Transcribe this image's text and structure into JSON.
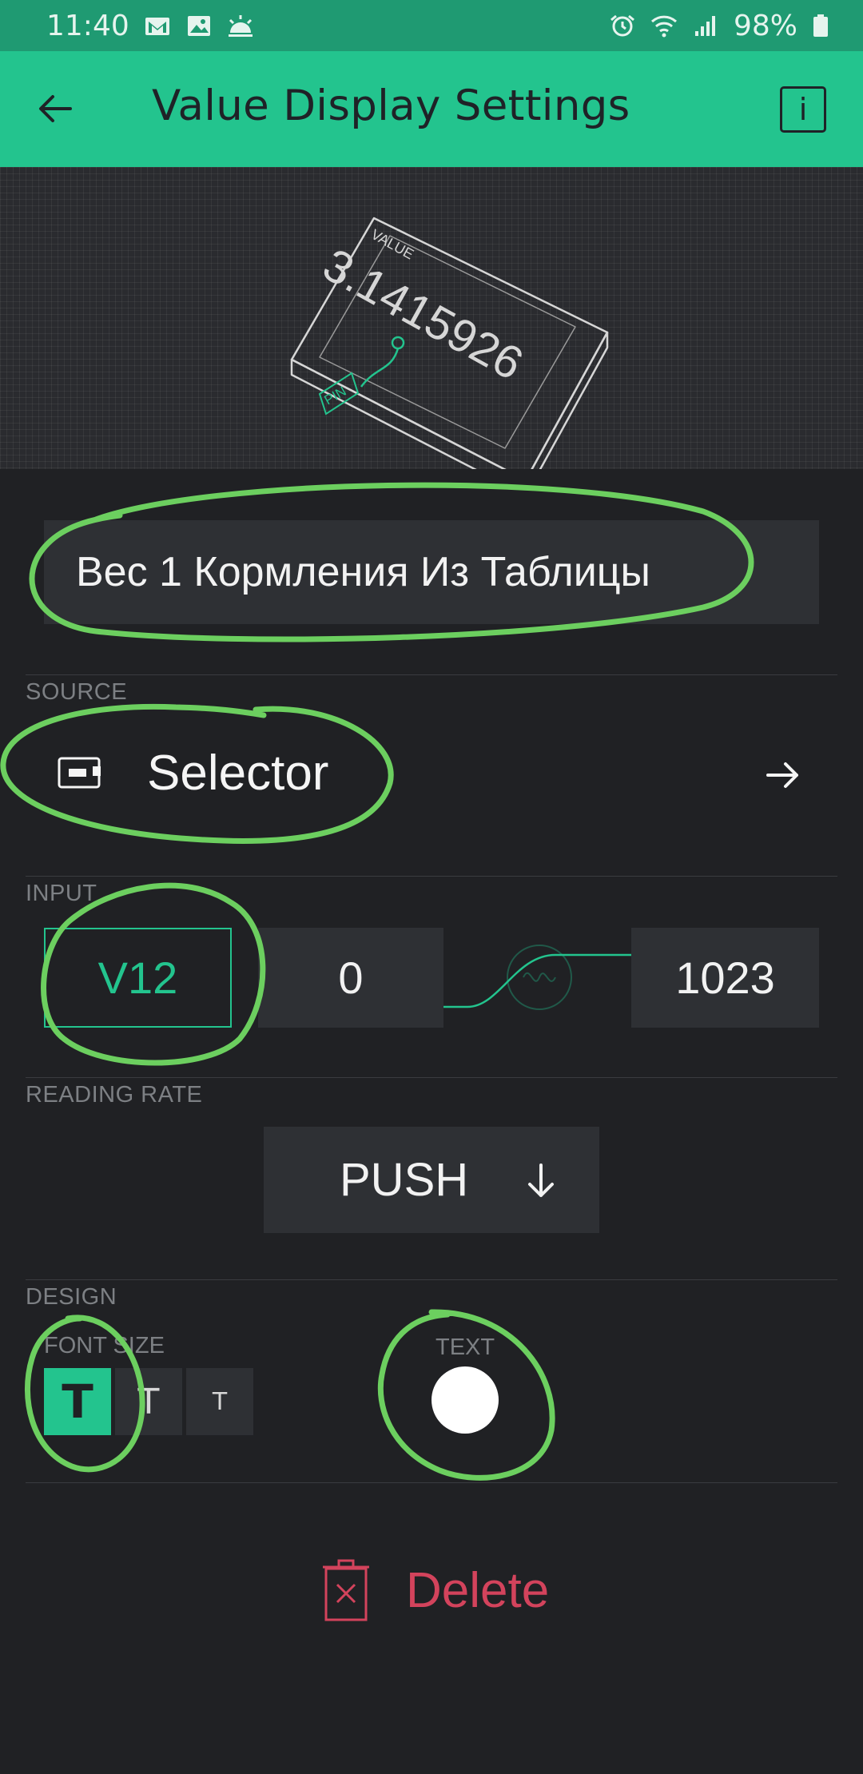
{
  "status_bar": {
    "time": "11:40",
    "left_icons": [
      "gmail-icon",
      "gallery-icon",
      "weather-icon"
    ],
    "right_icons": [
      "alarm-icon",
      "wifi-icon",
      "signal-icon",
      "battery-icon"
    ],
    "battery": "98%"
  },
  "app_bar": {
    "title": "Value Display Settings",
    "back_icon": "back-arrow-icon",
    "info_label": "i"
  },
  "preview": {
    "device_caption": "VALUE",
    "device_value": "3.1415926",
    "pin_label": "PIN"
  },
  "widget_name": "Вес 1 Кормления Из Таблицы",
  "source": {
    "section_label": "SOURCE",
    "device_name": "Selector",
    "icon": "device-icon",
    "arrow_icon": "arrow-right-icon"
  },
  "input": {
    "section_label": "INPUT",
    "pin": "V12",
    "min": "0",
    "max": "1023"
  },
  "reading_rate": {
    "section_label": "READING RATE",
    "value": "PUSH"
  },
  "design": {
    "section_label": "DESIGN",
    "font_size_label": "FONT SIZE",
    "font_size_options": [
      "T",
      "T",
      "T"
    ],
    "font_size_selected": 0,
    "text_color_label": "TEXT",
    "text_color": "#ffffff"
  },
  "delete_label": "Delete",
  "colors": {
    "accent": "#23c48e",
    "background": "#202124",
    "field": "#2e3034",
    "danger": "#d3435c",
    "annotation": "#6ccf5f"
  }
}
